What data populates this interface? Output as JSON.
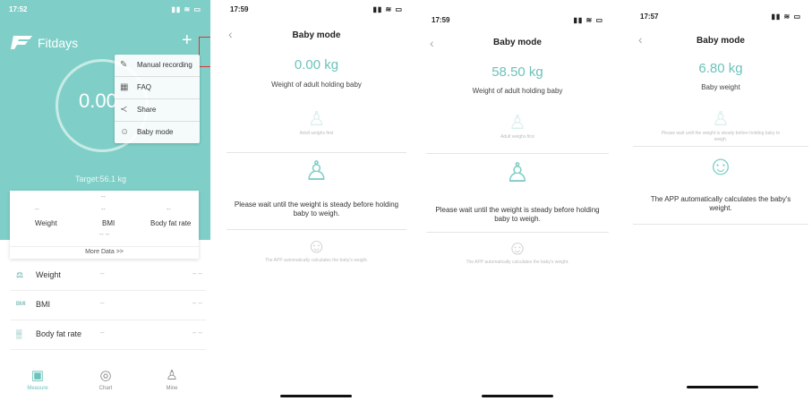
{
  "screen1": {
    "time": "17:52",
    "status_icons": "▮▮ ≋ ▭",
    "brand": "Fitdays",
    "weight_value": "0.00",
    "target": "Target:56.1 kg",
    "menu": [
      {
        "icon": "edit-icon",
        "glyph": "✎",
        "label": "Manual recording"
      },
      {
        "icon": "book-icon",
        "glyph": "▦",
        "label": "FAQ"
      },
      {
        "icon": "share-icon",
        "glyph": "≺",
        "label": "Share"
      },
      {
        "icon": "baby-icon",
        "glyph": "☺",
        "label": "Baby mode"
      }
    ],
    "card": {
      "metrics": [
        {
          "label": "Weight",
          "value": "--"
        },
        {
          "label": "BMI",
          "value": "--"
        },
        {
          "label": "Body fat rate",
          "value": "--"
        }
      ],
      "top_dash": "--",
      "bottom_dash": "-- --",
      "more": "More Data >>"
    },
    "rows": [
      {
        "icon": "scale-icon",
        "glyph": "⚖",
        "name": "Weight",
        "v1": "--",
        "v2": "-- --"
      },
      {
        "icon": "bmi-icon",
        "glyph": "BMI",
        "name": "BMI",
        "v1": "--",
        "v2": "-- --"
      },
      {
        "icon": "body-fat-icon",
        "glyph": "▒",
        "name": "Body fat rate",
        "v1": "--",
        "v2": "-- --"
      }
    ],
    "tabs": [
      {
        "icon": "measure-icon",
        "glyph": "▣",
        "label": "Measure"
      },
      {
        "icon": "chart-icon",
        "glyph": "◎",
        "label": "Chart"
      },
      {
        "icon": "person-icon",
        "glyph": "♙",
        "label": "Mine"
      }
    ]
  },
  "screen2": {
    "time": "17:59",
    "status_icons": "▮▮ ≋ ▭",
    "back": "‹",
    "title": "Baby mode",
    "kg": "0.00 kg",
    "sub": "Weight of adult holding baby",
    "step1": "Adult weighs first",
    "step2": "Please wait until the weight is steady before holding baby to weigh.",
    "step3": "The APP automatically calculates the baby's weight."
  },
  "screen3": {
    "time": "17:59",
    "status_icons": "▮▮ ≋ ▭",
    "back": "‹",
    "title": "Baby mode",
    "kg": "58.50 kg",
    "sub": "Weight of adult holding baby",
    "step1": "Adult weighs first",
    "step2": "Please wait until the weight is steady before holding baby to weigh.",
    "step3": "The APP automatically calculates the baby's weight."
  },
  "screen4": {
    "time": "17:57",
    "status_icons": "▮▮ ≋ ▭",
    "back": "‹",
    "title": "Baby mode",
    "kg": "6.80 kg",
    "sub": "Baby weight",
    "step1": "Please wait until the weight is steady before holding baby to weigh.",
    "step2": "The APP automatically calculates the baby's weight."
  }
}
